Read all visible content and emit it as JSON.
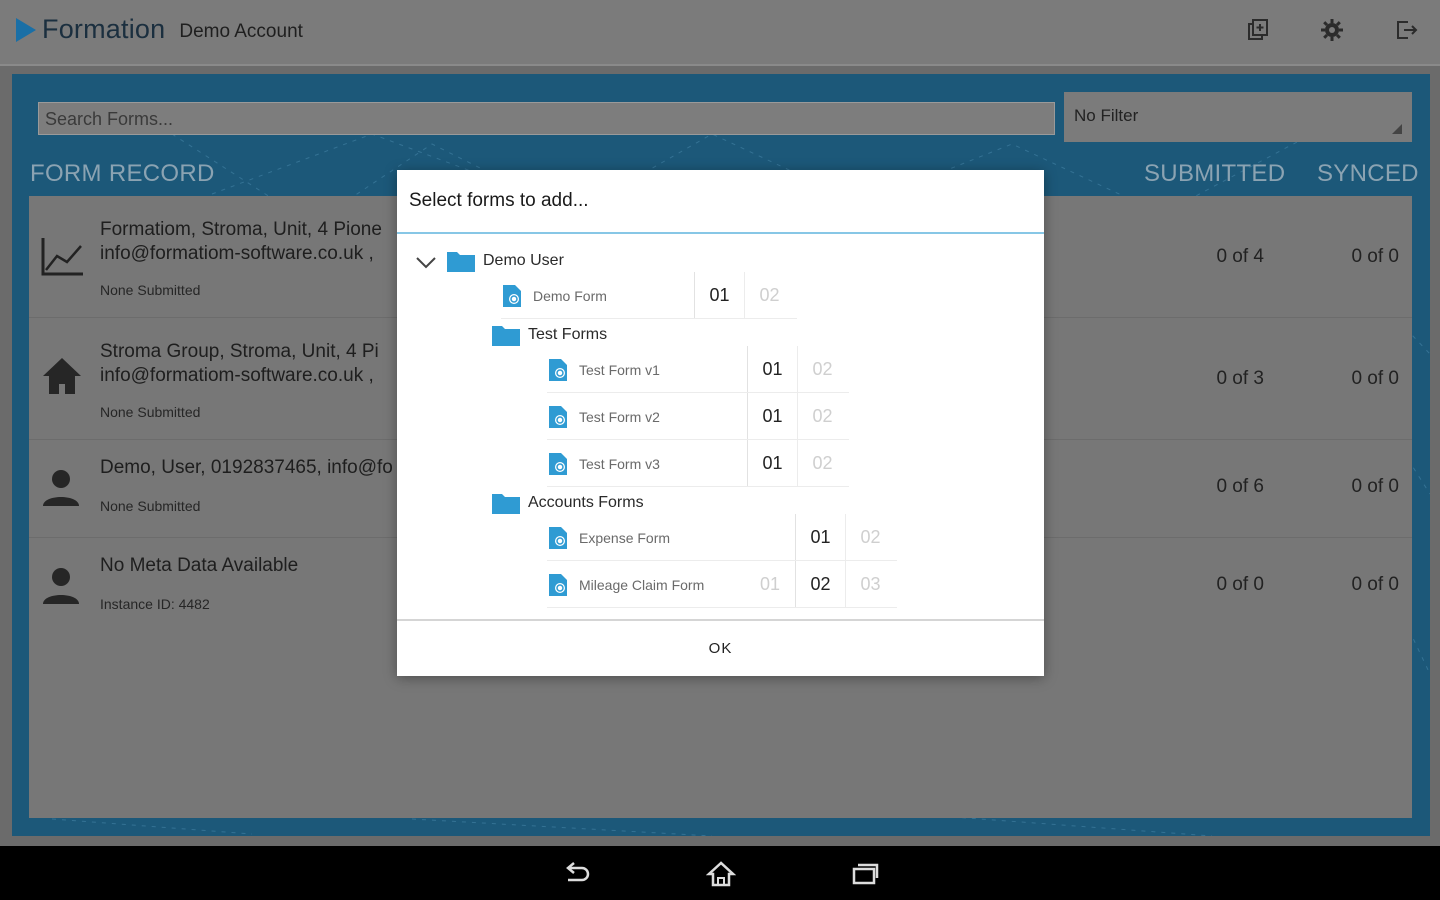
{
  "app": {
    "brand": "Formation",
    "account": "Demo Account",
    "actions": [
      {
        "name": "add-forms-icon"
      },
      {
        "name": "settings-icon"
      },
      {
        "name": "logout-icon"
      }
    ]
  },
  "search": {
    "placeholder": "Search Forms..."
  },
  "filter": {
    "value": "No Filter"
  },
  "table": {
    "headers": {
      "record": "FORM RECORD",
      "submitted": "SUBMITTED",
      "synced": "SYNCED"
    },
    "rows": [
      {
        "icon": "chart-icon",
        "title": "Formatiom, Stroma, Unit, 4 Pione\ninfo@formatiom-software.co.uk ,",
        "subtitle": "None Submitted",
        "submitted": "0 of 4",
        "synced": "0 of 0"
      },
      {
        "icon": "home-icon",
        "title": "Stroma Group, Stroma, Unit, 4 Pi\ninfo@formatiom-software.co.uk ,",
        "subtitle": "None Submitted",
        "submitted": "0 of 3",
        "synced": "0 of 0"
      },
      {
        "icon": "person-icon",
        "title": "Demo, User, 0192837465, info@fo",
        "subtitle": "None Submitted",
        "submitted": "0 of 6",
        "synced": "0 of 0"
      },
      {
        "icon": "person-icon",
        "title": "No Meta Data Available",
        "subtitle": "Instance ID: 4482",
        "submitted": "0 of 0",
        "synced": "0 of 0"
      }
    ]
  },
  "dialog": {
    "title": "Select forms to add...",
    "ok": "OK",
    "root": "Demo User",
    "demo_form": {
      "label": "Demo Form",
      "versions": [
        "01",
        "02"
      ]
    },
    "test_group": "Test Forms",
    "test_forms": [
      {
        "label": "Test Form v1",
        "versions": [
          "01",
          "02"
        ]
      },
      {
        "label": "Test Form v2",
        "versions": [
          "01",
          "02"
        ]
      },
      {
        "label": "Test Form v3",
        "versions": [
          "01",
          "02"
        ]
      }
    ],
    "accounts_group": "Accounts Forms",
    "expense_form": {
      "label": "Expense Form",
      "versions": [
        "01",
        "02"
      ]
    },
    "mileage_form": {
      "label": "Mileage Claim Form",
      "versions": [
        "01",
        "02",
        "03"
      ]
    }
  },
  "colors": {
    "accent": "#1a6fa6",
    "panel": "#1c5879",
    "dialog_rule": "#87c7e6",
    "folder": "#2f9bd3"
  }
}
